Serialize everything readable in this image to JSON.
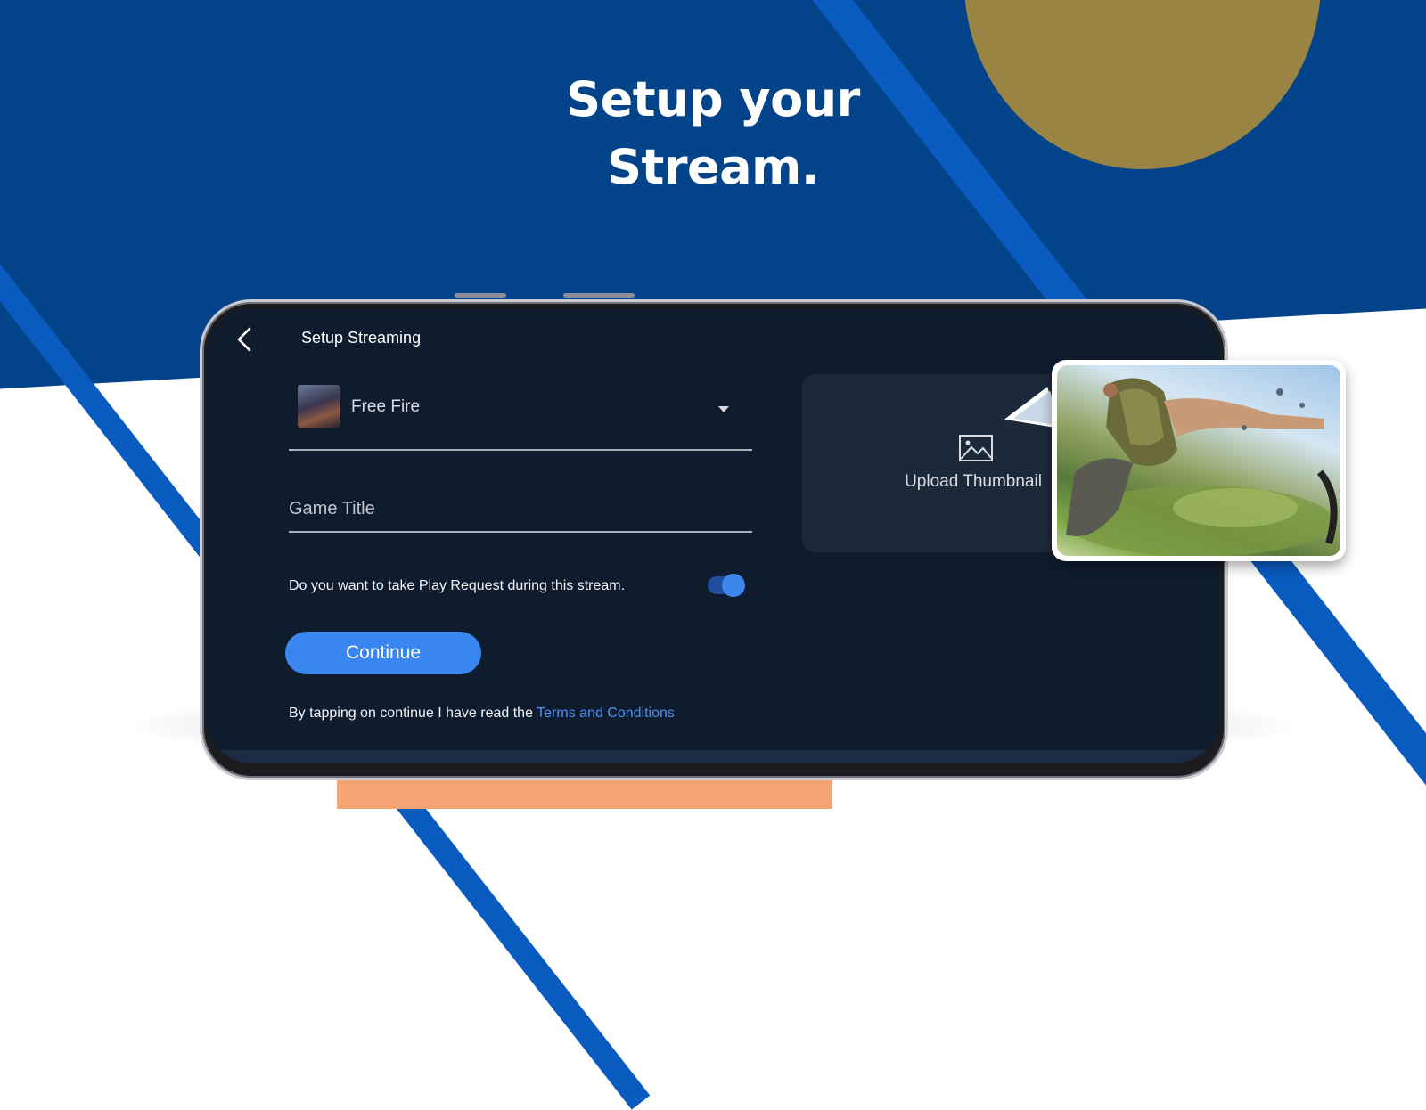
{
  "hero": {
    "headline_line1": "Setup your",
    "headline_line2": "Stream."
  },
  "header": {
    "title": "Setup Streaming"
  },
  "game_select": {
    "selected": "Free Fire"
  },
  "title_field": {
    "placeholder": "Game Title"
  },
  "play_request": {
    "label": "Do you want to take Play Request during this stream.",
    "enabled": true
  },
  "continue_button": {
    "label": "Continue"
  },
  "terms": {
    "prefix": "By tapping on continue I have read the ",
    "link": "Terms and Conditions"
  },
  "thumbnail": {
    "label": "Upload Thumbnail"
  },
  "colors": {
    "accent": "#3a86f0",
    "background_blue": "#034389",
    "screen": "#0f1c2e",
    "sun": "#9a8444"
  },
  "icons": {
    "back": "back-arrow-icon",
    "dropdown": "chevron-down-icon",
    "image": "image-icon"
  }
}
